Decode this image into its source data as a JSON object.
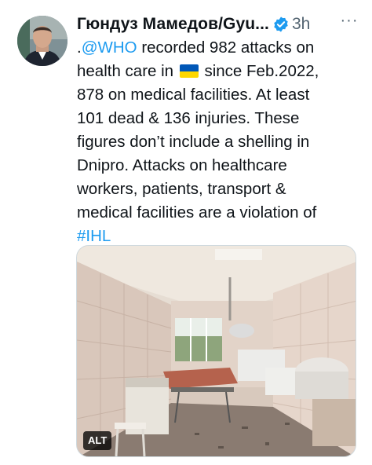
{
  "tweet": {
    "author_name": "Гюндуз Мамедов/Gyu...",
    "verified_icon": "verified-badge-icon",
    "time_label": "3h",
    "more_label": "···",
    "text": {
      "mention": "@WHO",
      "line1_prefix": ".",
      "line1_rest": " recorded 982 attacks on",
      "line2_prefix": "health care in ",
      "flag_icon": "ukraine-flag-icon",
      "line2_rest": " since Feb.2022,",
      "line3": "878 on medical facilities. At least",
      "line4": "101 dead & 136 injuries. These",
      "line5": "figures don’t include a shelling in",
      "line6": "Dnipro. Attacks on healthcare",
      "line7": "workers, patients, transport &",
      "line8": "medical facilities are a violation of",
      "hashtag": "#IHL"
    },
    "media": {
      "alt_label": "ALT"
    }
  },
  "colors": {
    "link": "#1d9bf0",
    "verified": "#1d9bf0",
    "muted": "#536471",
    "text": "#0f1419"
  }
}
